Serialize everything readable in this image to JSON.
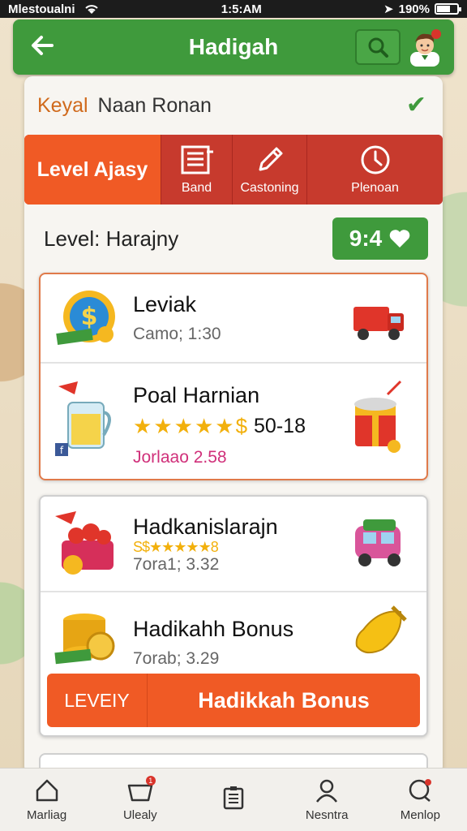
{
  "status_bar": {
    "carrier": "Mlestoualni",
    "time": "1:5:AM",
    "battery": "190%"
  },
  "app_bar": {
    "title": "Hadigah"
  },
  "header": {
    "label": "Keyal",
    "value": "Naan Ronan"
  },
  "tabs": {
    "primary_label": "Level Ajasy",
    "items": [
      {
        "label": "Band",
        "icon": "list-icon"
      },
      {
        "label": "Castoning",
        "icon": "pencil-icon"
      },
      {
        "label": "Plenoan",
        "icon": "clock-icon"
      }
    ]
  },
  "level_row": {
    "label": "Level: Harajny",
    "score": "9:4"
  },
  "card1": {
    "items": [
      {
        "title": "Leviak",
        "sub": "Camo; 1:30"
      },
      {
        "title": "Poal Harnian",
        "rating_value": "50-18",
        "sub": "Jorlaao 2.58"
      }
    ]
  },
  "card2": {
    "items": [
      {
        "title": "Hadkanislarajn",
        "stars_text": "S$★★★★★8",
        "sub": "7ora1; 3.32"
      },
      {
        "title": "Hadikahh Bonus",
        "sub": "7orab; 3.29"
      }
    ],
    "bonus_bar": {
      "left_label": "LEVEIY",
      "right_label": "Hadikkah Bonus"
    }
  },
  "bottom_nav": [
    {
      "label": "Marliag",
      "icon": "home-icon"
    },
    {
      "label": "Ulealy",
      "icon": "basket-icon",
      "badge": "1"
    },
    {
      "label": "",
      "icon": "clipboard-icon"
    },
    {
      "label": "Nesntra",
      "icon": "profile-icon"
    },
    {
      "label": "Menlop",
      "icon": "chat-icon"
    }
  ],
  "colors": {
    "green": "#3f9a3c",
    "orange": "#f05a25",
    "red": "#c9352b"
  }
}
